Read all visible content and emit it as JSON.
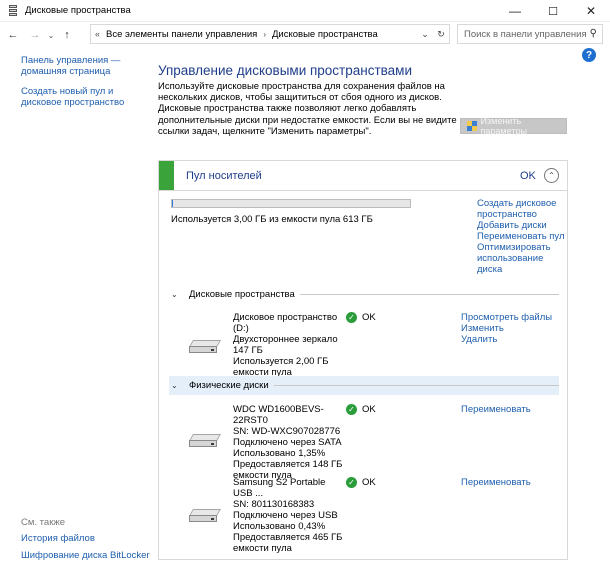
{
  "window": {
    "title": "Дисковые пространства",
    "minimize": "—",
    "maximize": "☐",
    "close": "✕"
  },
  "nav": {
    "back": "←",
    "forward": "→",
    "recent": "⌄",
    "up": "↑",
    "address_icon": "«",
    "breadcrumbs": [
      "Все элементы панели управления",
      "Дисковые пространства"
    ],
    "breadcrumb_separator": "›",
    "dropdown": "⌄",
    "refresh": "↻",
    "search_placeholder": "Поиск в панели управления",
    "search_icon": "⚲"
  },
  "help": "?",
  "sidebar": {
    "items": [
      {
        "label": "Панель управления — домашняя страница"
      },
      {
        "label": "Создать новый пул и дисковое пространство"
      }
    ],
    "see_also": "См. также",
    "bottom_items": [
      {
        "label": "История файлов"
      },
      {
        "label": "Шифрование диска BitLocker"
      }
    ]
  },
  "main": {
    "title": "Управление дисковыми пространствами",
    "intro": "Используйте дисковые пространства для сохранения файлов на нескольких дисков, чтобы защититься от сбоя одного из дисков. Дисковые пространства также позволяют легко добавлять дополнительные диски при недостатке емкости. Если вы не видите ссылки задач, щелкните \"Изменить параметры\".",
    "change_settings": "Изменить параметры"
  },
  "pool": {
    "name": "Пул носителей",
    "status": "OK",
    "usage_fraction": 0.005,
    "usage_text": "Используется 3,00 ГБ из емкости пула 613 ГБ",
    "links": [
      {
        "label": "Создать дисковое пространство"
      },
      {
        "label": "Добавить диски"
      },
      {
        "label": "Переименовать пул"
      },
      {
        "label": "Оптимизировать использование диска"
      }
    ],
    "spaces_section": "Дисковые пространства",
    "spaces": [
      {
        "lines": [
          "Дисковое пространство (D:)",
          "Двухстороннее зеркало",
          "147 ГБ",
          "Используется 2,00 ГБ емкости пула"
        ],
        "status": "OK",
        "links": [
          "Просмотреть файлы",
          "Изменить",
          "Удалить"
        ]
      }
    ],
    "disks_section": "Физические диски",
    "disks": [
      {
        "lines": [
          "WDC WD1600BEVS-22RST0",
          "SN: WD-WXC907028776",
          "Подключено через SATA",
          "Использовано 1,35%",
          "Предоставляется 148 ГБ емкости пула"
        ],
        "status": "OK",
        "links": [
          "Переименовать"
        ]
      },
      {
        "lines": [
          "Samsung S2 Portable USB ...",
          "SN: 801130168383",
          "Подключено через USB",
          "Использовано 0,43%",
          "Предоставляется 465 ГБ емкости пула"
        ],
        "status": "OK",
        "links": [
          "Переименовать"
        ]
      }
    ]
  }
}
